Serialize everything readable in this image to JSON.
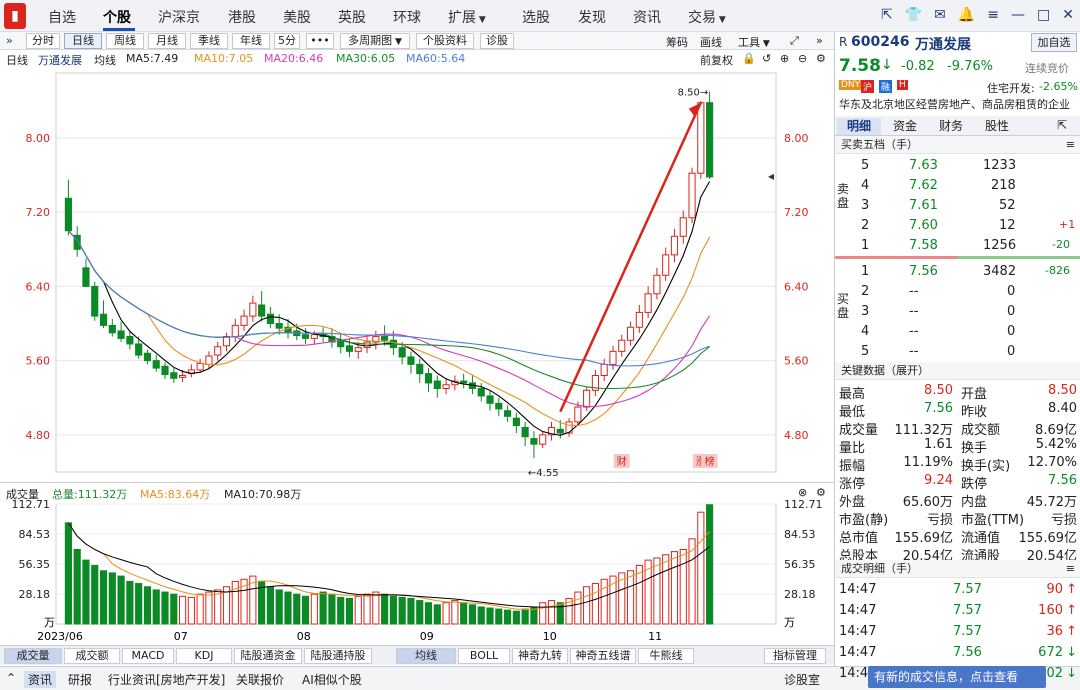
{
  "nav": {
    "items": [
      "自选",
      "个股",
      "沪深京",
      "港股",
      "美股",
      "英股",
      "环球",
      "扩展",
      "选股",
      "发现",
      "资讯",
      "交易"
    ],
    "active": "个股"
  },
  "toolbar": {
    "periods": [
      "分时",
      "日线",
      "周线",
      "月线",
      "季线",
      "年线",
      "5分"
    ],
    "active_period": "日线",
    "more": "•••",
    "multi": "多周期图",
    "profile": "个股资料",
    "diagnose": "诊股",
    "right_tools": [
      "筹码",
      "画线",
      "工具"
    ]
  },
  "ma": {
    "period": "日线",
    "name": "万通发展",
    "type": "均线",
    "ma5": "MA5:7.49",
    "ma10": "MA10:7.05",
    "ma20": "MA20:6.46",
    "ma30": "MA30:6.05",
    "ma60": "MA60:5.64",
    "adjust": "前复权"
  },
  "chart_data": {
    "type": "candlestick",
    "title": "万通发展 日线",
    "x_ticks": [
      "2023/06",
      "07",
      "08",
      "09",
      "10",
      "11"
    ],
    "y_ticks": [
      "8.00",
      "7.20",
      "6.40",
      "5.60",
      "4.80"
    ],
    "ylim": [
      4.55,
      8.5
    ],
    "annotations": {
      "high": "8.50",
      "low": "4.55",
      "markers": [
        "财",
        "涨",
        "榜"
      ]
    },
    "candles": [
      [
        7.35,
        7.55,
        7.0,
        6.95
      ],
      [
        6.95,
        7.05,
        6.8,
        6.72
      ],
      [
        6.6,
        6.7,
        6.4,
        6.42
      ],
      [
        6.4,
        6.45,
        6.08,
        6.03
      ],
      [
        6.1,
        6.25,
        5.98,
        5.95
      ],
      [
        5.98,
        6.05,
        5.9,
        5.86
      ],
      [
        5.92,
        6.02,
        5.84,
        5.8
      ],
      [
        5.86,
        5.92,
        5.78,
        5.72
      ],
      [
        5.78,
        5.86,
        5.66,
        5.62
      ],
      [
        5.68,
        5.72,
        5.6,
        5.56
      ],
      [
        5.6,
        5.66,
        5.52,
        5.48
      ],
      [
        5.54,
        5.58,
        5.45,
        5.4
      ],
      [
        5.47,
        5.52,
        5.41,
        5.36
      ],
      [
        5.42,
        5.5,
        5.44,
        5.37
      ],
      [
        5.46,
        5.56,
        5.5,
        5.42
      ],
      [
        5.5,
        5.62,
        5.57,
        5.47
      ],
      [
        5.56,
        5.7,
        5.65,
        5.52
      ],
      [
        5.66,
        5.8,
        5.75,
        5.6
      ],
      [
        5.76,
        5.9,
        5.86,
        5.7
      ],
      [
        5.86,
        6.05,
        5.98,
        5.8
      ],
      [
        5.98,
        6.15,
        6.08,
        5.92
      ],
      [
        6.08,
        6.3,
        6.22,
        6.02
      ],
      [
        6.2,
        6.35,
        6.08,
        6.02
      ],
      [
        6.1,
        6.18,
        6.0,
        5.95
      ],
      [
        6.0,
        6.1,
        5.95,
        5.88
      ],
      [
        5.96,
        6.05,
        5.9,
        5.84
      ],
      [
        5.92,
        6.0,
        5.87,
        5.82
      ],
      [
        5.88,
        5.95,
        5.84,
        5.78
      ],
      [
        5.84,
        5.92,
        5.88,
        5.78
      ],
      [
        5.88,
        5.96,
        5.86,
        5.8
      ],
      [
        5.86,
        5.95,
        5.8,
        5.74
      ],
      [
        5.82,
        5.9,
        5.75,
        5.68
      ],
      [
        5.76,
        5.84,
        5.7,
        5.64
      ],
      [
        5.7,
        5.8,
        5.74,
        5.62
      ],
      [
        5.74,
        5.86,
        5.8,
        5.68
      ],
      [
        5.8,
        5.92,
        5.86,
        5.72
      ],
      [
        5.86,
        5.98,
        5.82,
        5.76
      ],
      [
        5.82,
        5.92,
        5.74,
        5.66
      ],
      [
        5.74,
        5.8,
        5.64,
        5.56
      ],
      [
        5.64,
        5.7,
        5.56,
        5.46
      ],
      [
        5.56,
        5.62,
        5.46,
        5.36
      ],
      [
        5.46,
        5.52,
        5.36,
        5.26
      ],
      [
        5.38,
        5.44,
        5.3,
        5.2
      ],
      [
        5.3,
        5.4,
        5.34,
        5.24
      ],
      [
        5.34,
        5.44,
        5.38,
        5.28
      ],
      [
        5.38,
        5.46,
        5.36,
        5.3
      ],
      [
        5.36,
        5.44,
        5.3,
        5.24
      ],
      [
        5.3,
        5.36,
        5.22,
        5.16
      ],
      [
        5.22,
        5.28,
        5.14,
        5.06
      ],
      [
        5.14,
        5.2,
        5.08,
        5.0
      ],
      [
        5.06,
        5.12,
        5.0,
        4.94
      ],
      [
        4.98,
        5.04,
        4.9,
        4.82
      ],
      [
        4.88,
        4.94,
        4.78,
        4.68
      ],
      [
        4.76,
        4.84,
        4.7,
        4.55
      ],
      [
        4.7,
        4.84,
        4.8,
        4.66
      ],
      [
        4.8,
        4.94,
        4.88,
        4.74
      ],
      [
        4.86,
        4.96,
        4.82,
        4.76
      ],
      [
        4.82,
        4.98,
        4.94,
        4.78
      ],
      [
        4.94,
        5.16,
        5.1,
        4.9
      ],
      [
        5.1,
        5.32,
        5.28,
        5.06
      ],
      [
        5.28,
        5.5,
        5.44,
        5.22
      ],
      [
        5.44,
        5.62,
        5.56,
        5.38
      ],
      [
        5.56,
        5.76,
        5.7,
        5.5
      ],
      [
        5.7,
        5.88,
        5.82,
        5.64
      ],
      [
        5.82,
        6.02,
        5.96,
        5.76
      ],
      [
        5.96,
        6.2,
        6.12,
        5.9
      ],
      [
        6.12,
        6.4,
        6.32,
        6.06
      ],
      [
        6.32,
        6.6,
        6.52,
        6.26
      ],
      [
        6.52,
        6.82,
        6.74,
        6.46
      ],
      [
        6.74,
        7.02,
        6.94,
        6.66
      ],
      [
        6.94,
        7.22,
        7.14,
        6.86
      ],
      [
        7.14,
        7.68,
        7.62,
        7.08
      ],
      [
        7.62,
        8.4,
        8.38,
        7.56
      ],
      [
        8.38,
        8.5,
        7.58,
        7.56
      ]
    ],
    "ma_lines": [
      "MA5",
      "MA10",
      "MA20",
      "MA30",
      "MA60"
    ]
  },
  "volume": {
    "label": "成交量",
    "total": "总量:111.32万",
    "ma5": "MA5:83.64万",
    "ma10": "MA10:70.98万",
    "y_ticks": [
      "112.71",
      "84.53",
      "56.35",
      "28.18"
    ],
    "unit": "万"
  },
  "volume_data": [
    95,
    70,
    60,
    55,
    50,
    48,
    45,
    40,
    38,
    35,
    32,
    30,
    28,
    26,
    25,
    28,
    30,
    32,
    35,
    40,
    42,
    45,
    40,
    35,
    32,
    30,
    28,
    26,
    28,
    30,
    28,
    25,
    24,
    26,
    28,
    30,
    28,
    26,
    25,
    24,
    22,
    20,
    18,
    20,
    22,
    20,
    18,
    16,
    15,
    14,
    13,
    12,
    14,
    16,
    20,
    22,
    20,
    24,
    30,
    35,
    38,
    42,
    45,
    48,
    50,
    55,
    60,
    62,
    65,
    68,
    70,
    80,
    105,
    112
  ],
  "panel_tabs": [
    "成交量",
    "成交额",
    "MACD",
    "KDJ",
    "陆股通资金",
    "陆股通持股",
    "均线",
    "BOLL",
    "神奇九转",
    "神奇五线谱",
    "牛熊线"
  ],
  "panel_active": [
    "成交量",
    "均线"
  ],
  "indicator_mgr": "指标管理",
  "bottom_tabs": [
    "资讯",
    "研报",
    "行业资讯[房地产开发]",
    "关联报价",
    "AI相似个股",
    "诊股室"
  ],
  "stock": {
    "prefix": "R",
    "code": "600246",
    "name": "万通发展",
    "add_btn": "加自选",
    "price": "7.58",
    "change": "-0.82",
    "pct": "-9.76%",
    "arrow": "↓",
    "status": "连续竞价",
    "sector_label": "住宅开发:",
    "sector_pct": "-2.65%",
    "tags": [
      "DNY",
      "沪",
      "融",
      "H"
    ],
    "desc": "华东及北京地区经营房地产、商品房租赁的企业"
  },
  "right_tabs": [
    "明细",
    "资金",
    "财务",
    "股性"
  ],
  "orderbook": {
    "title": "买卖五档（手）",
    "sell_label": "卖盘",
    "buy_label": "买盘",
    "sells": [
      {
        "n": "5",
        "p": "7.63",
        "v": "1233",
        "d": ""
      },
      {
        "n": "4",
        "p": "7.62",
        "v": "218",
        "d": ""
      },
      {
        "n": "3",
        "p": "7.61",
        "v": "52",
        "d": ""
      },
      {
        "n": "2",
        "p": "7.60",
        "v": "12",
        "d": "+1"
      },
      {
        "n": "1",
        "p": "7.58",
        "v": "1256",
        "d": "-20"
      }
    ],
    "buys": [
      {
        "n": "1",
        "p": "7.56",
        "v": "3482",
        "d": "-826"
      },
      {
        "n": "2",
        "p": "--",
        "v": "0",
        "d": ""
      },
      {
        "n": "3",
        "p": "--",
        "v": "0",
        "d": ""
      },
      {
        "n": "4",
        "p": "--",
        "v": "0",
        "d": ""
      },
      {
        "n": "5",
        "p": "--",
        "v": "0",
        "d": ""
      }
    ]
  },
  "keydata": {
    "title": "关键数据（展开）",
    "rows": [
      [
        "最高",
        "8.50",
        "开盘",
        "8.50"
      ],
      [
        "最低",
        "7.56",
        "昨收",
        "8.40"
      ],
      [
        "成交量",
        "111.32万",
        "成交额",
        "8.69亿"
      ],
      [
        "量比",
        "1.61",
        "换手",
        "5.42%"
      ],
      [
        "振幅",
        "11.19%",
        "换手(实)",
        "12.70%"
      ],
      [
        "涨停",
        "9.24",
        "跌停",
        "7.56"
      ],
      [
        "外盘",
        "65.60万",
        "内盘",
        "45.72万"
      ],
      [
        "市盈(静)",
        "亏损",
        "市盈(TTM)",
        "亏损"
      ],
      [
        "总市值",
        "155.69亿",
        "流通值",
        "155.69亿"
      ],
      [
        "总股本",
        "20.54亿",
        "流通股",
        "20.54亿"
      ]
    ]
  },
  "trades": {
    "title": "成交明细（手）",
    "rows": [
      [
        "14:47",
        "7.57",
        "90",
        "up"
      ],
      [
        "14:47",
        "7.57",
        "160",
        "up"
      ],
      [
        "14:47",
        "7.57",
        "36",
        "up"
      ],
      [
        "14:47",
        "7.56",
        "672",
        "down"
      ],
      [
        "14:47",
        "7.56",
        "102",
        "down"
      ]
    ]
  },
  "notice": "有新的成交信息，点击查看",
  "colors": {
    "up": "#d9261c",
    "down": "#0b8a26",
    "ma5": "#000000",
    "ma10": "#e8901c",
    "ma20": "#d63ab8",
    "ma30": "#1a8a30",
    "ma60": "#4d7fcf"
  }
}
